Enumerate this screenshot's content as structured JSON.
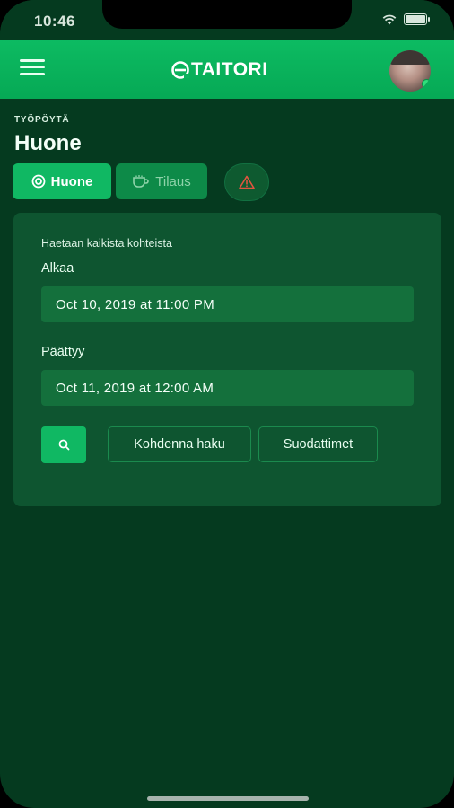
{
  "status_bar": {
    "time": "10:46"
  },
  "header": {
    "logo_text": "TAITORI",
    "menu_icon": "hamburger-icon",
    "avatar": "user-avatar"
  },
  "page": {
    "breadcrumb": "TYÖPÖYTÄ",
    "title": "Huone"
  },
  "tabs": [
    {
      "label": "Huone",
      "icon": "target-icon",
      "active": true
    },
    {
      "label": "Tilaus",
      "icon": "coffee-cup-icon",
      "active": false
    },
    {
      "label": "",
      "icon": "warning-triangle-icon",
      "active": false
    }
  ],
  "search_card": {
    "hint": "Haetaan kaikista kohteista",
    "start_label": "Alkaa",
    "start_value": "Oct 10, 2019 at 11:00 PM",
    "end_label": "Päättyy",
    "end_value": "Oct 11, 2019 at 12:00 AM",
    "search_icon": "search-icon",
    "refine_label": "Kohdenna haku",
    "filters_label": "Suodattimet"
  },
  "colors": {
    "background": "#053a1f",
    "header_green": "#0dbb62",
    "accent": "#10b863",
    "card": "#0e5530",
    "alert": "#e0553f"
  }
}
